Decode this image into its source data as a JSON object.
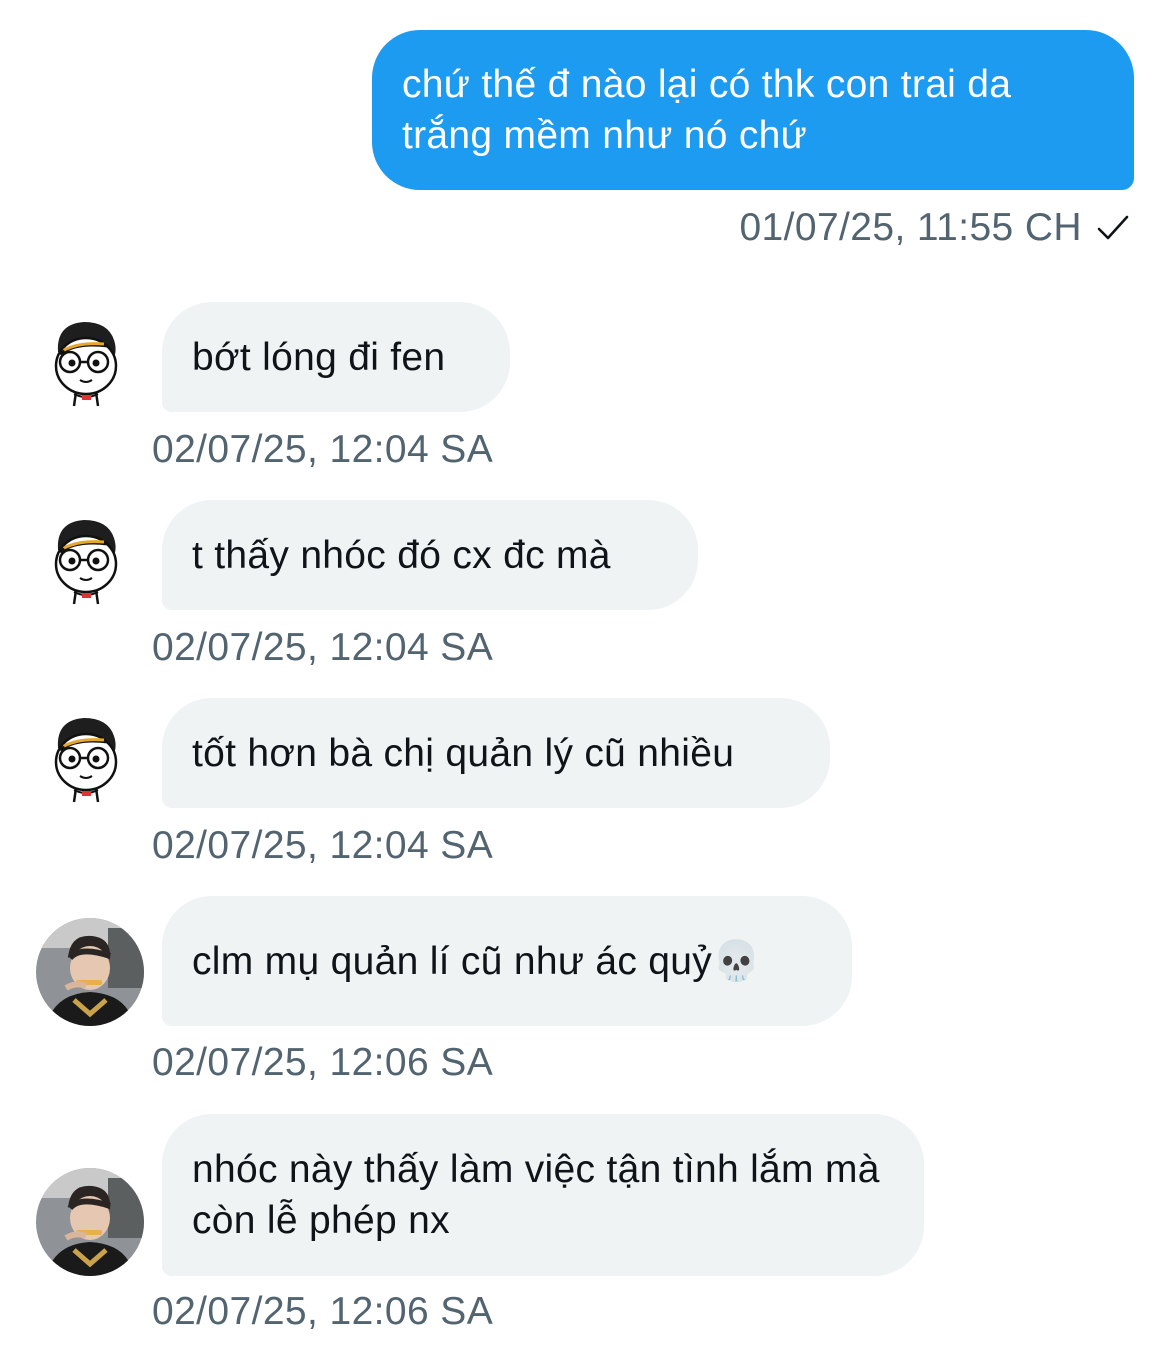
{
  "outgoing": {
    "text": "chứ thế đ nào lại có thk con trai da trắng mềm như nó chứ",
    "timestamp": "01/07/25, 11:55 CH",
    "status_icon": "check-icon"
  },
  "incoming": [
    {
      "text": "bớt lóng đi fen",
      "timestamp": "02/07/25, 12:04 SA",
      "avatar": "cartoon-avatar"
    },
    {
      "text": "t thấy nhóc đó cx đc mà",
      "timestamp": "02/07/25, 12:04 SA",
      "avatar": "cartoon-avatar"
    },
    {
      "text": "tốt hơn bà chị quản lý cũ nhiều",
      "timestamp": "02/07/25, 12:04 SA",
      "avatar": "cartoon-avatar"
    },
    {
      "text": "clm mụ quản lí cũ như ác quỷ💀",
      "timestamp": "02/07/25, 12:06 SA",
      "avatar": "photo-avatar"
    },
    {
      "text": "nhóc này thấy làm việc tận tình lắm mà còn lễ phép nx",
      "timestamp": "02/07/25, 12:06 SA",
      "avatar": "photo-avatar"
    }
  ],
  "colors": {
    "outgoing_bubble": "#1d9bf0",
    "incoming_bubble": "#eff3f4",
    "timestamp": "#536471"
  }
}
